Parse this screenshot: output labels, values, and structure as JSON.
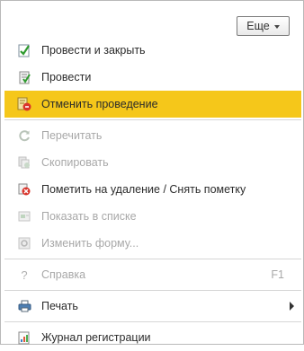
{
  "toolbar": {
    "more_label": "Еще"
  },
  "menu": {
    "items": [
      {
        "label": "Провести и закрыть",
        "icon": "post-and-close-icon"
      },
      {
        "label": "Провести",
        "icon": "post-icon"
      },
      {
        "label": "Отменить проведение",
        "icon": "cancel-posting-icon",
        "selected": true
      },
      {
        "label": "Перечитать",
        "icon": "reread-icon",
        "disabled": true
      },
      {
        "label": "Скопировать",
        "icon": "copy-icon",
        "disabled": true
      },
      {
        "label": "Пометить на удаление / Снять пометку",
        "icon": "mark-deletion-icon"
      },
      {
        "label": "Показать в списке",
        "icon": "show-in-list-icon",
        "disabled": true
      },
      {
        "label": "Изменить форму...",
        "icon": "change-form-icon",
        "disabled": true
      },
      {
        "label": "Справка",
        "icon": "help-icon",
        "disabled": true,
        "shortcut": "F1"
      },
      {
        "label": "Печать",
        "icon": "print-icon",
        "submenu": true
      },
      {
        "label": "Журнал регистрации",
        "icon": "event-log-icon"
      }
    ]
  },
  "colors": {
    "highlight": "#f5c71a",
    "disabled_text": "#a8a8a8"
  }
}
